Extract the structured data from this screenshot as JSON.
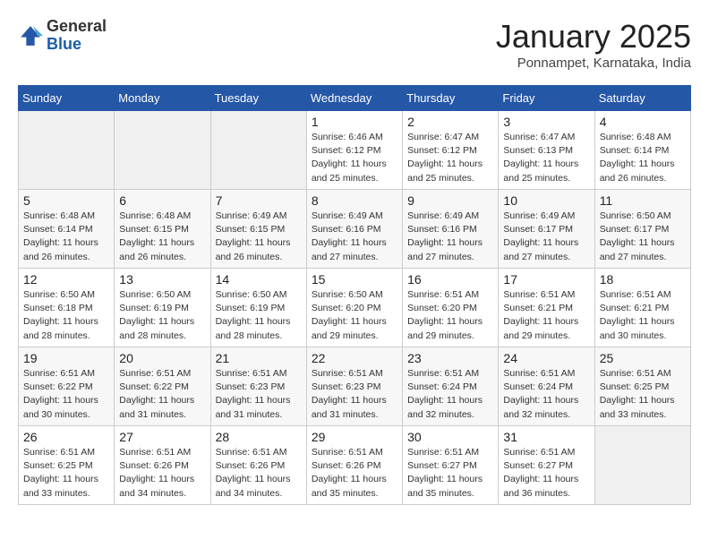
{
  "header": {
    "logo_general": "General",
    "logo_blue": "Blue",
    "month_title": "January 2025",
    "location": "Ponnampet, Karnataka, India"
  },
  "weekdays": [
    "Sunday",
    "Monday",
    "Tuesday",
    "Wednesday",
    "Thursday",
    "Friday",
    "Saturday"
  ],
  "weeks": [
    [
      {
        "day": "",
        "info": ""
      },
      {
        "day": "",
        "info": ""
      },
      {
        "day": "",
        "info": ""
      },
      {
        "day": "1",
        "info": "Sunrise: 6:46 AM\nSunset: 6:12 PM\nDaylight: 11 hours\nand 25 minutes."
      },
      {
        "day": "2",
        "info": "Sunrise: 6:47 AM\nSunset: 6:12 PM\nDaylight: 11 hours\nand 25 minutes."
      },
      {
        "day": "3",
        "info": "Sunrise: 6:47 AM\nSunset: 6:13 PM\nDaylight: 11 hours\nand 25 minutes."
      },
      {
        "day": "4",
        "info": "Sunrise: 6:48 AM\nSunset: 6:14 PM\nDaylight: 11 hours\nand 26 minutes."
      }
    ],
    [
      {
        "day": "5",
        "info": "Sunrise: 6:48 AM\nSunset: 6:14 PM\nDaylight: 11 hours\nand 26 minutes."
      },
      {
        "day": "6",
        "info": "Sunrise: 6:48 AM\nSunset: 6:15 PM\nDaylight: 11 hours\nand 26 minutes."
      },
      {
        "day": "7",
        "info": "Sunrise: 6:49 AM\nSunset: 6:15 PM\nDaylight: 11 hours\nand 26 minutes."
      },
      {
        "day": "8",
        "info": "Sunrise: 6:49 AM\nSunset: 6:16 PM\nDaylight: 11 hours\nand 27 minutes."
      },
      {
        "day": "9",
        "info": "Sunrise: 6:49 AM\nSunset: 6:16 PM\nDaylight: 11 hours\nand 27 minutes."
      },
      {
        "day": "10",
        "info": "Sunrise: 6:49 AM\nSunset: 6:17 PM\nDaylight: 11 hours\nand 27 minutes."
      },
      {
        "day": "11",
        "info": "Sunrise: 6:50 AM\nSunset: 6:17 PM\nDaylight: 11 hours\nand 27 minutes."
      }
    ],
    [
      {
        "day": "12",
        "info": "Sunrise: 6:50 AM\nSunset: 6:18 PM\nDaylight: 11 hours\nand 28 minutes."
      },
      {
        "day": "13",
        "info": "Sunrise: 6:50 AM\nSunset: 6:19 PM\nDaylight: 11 hours\nand 28 minutes."
      },
      {
        "day": "14",
        "info": "Sunrise: 6:50 AM\nSunset: 6:19 PM\nDaylight: 11 hours\nand 28 minutes."
      },
      {
        "day": "15",
        "info": "Sunrise: 6:50 AM\nSunset: 6:20 PM\nDaylight: 11 hours\nand 29 minutes."
      },
      {
        "day": "16",
        "info": "Sunrise: 6:51 AM\nSunset: 6:20 PM\nDaylight: 11 hours\nand 29 minutes."
      },
      {
        "day": "17",
        "info": "Sunrise: 6:51 AM\nSunset: 6:21 PM\nDaylight: 11 hours\nand 29 minutes."
      },
      {
        "day": "18",
        "info": "Sunrise: 6:51 AM\nSunset: 6:21 PM\nDaylight: 11 hours\nand 30 minutes."
      }
    ],
    [
      {
        "day": "19",
        "info": "Sunrise: 6:51 AM\nSunset: 6:22 PM\nDaylight: 11 hours\nand 30 minutes."
      },
      {
        "day": "20",
        "info": "Sunrise: 6:51 AM\nSunset: 6:22 PM\nDaylight: 11 hours\nand 31 minutes."
      },
      {
        "day": "21",
        "info": "Sunrise: 6:51 AM\nSunset: 6:23 PM\nDaylight: 11 hours\nand 31 minutes."
      },
      {
        "day": "22",
        "info": "Sunrise: 6:51 AM\nSunset: 6:23 PM\nDaylight: 11 hours\nand 31 minutes."
      },
      {
        "day": "23",
        "info": "Sunrise: 6:51 AM\nSunset: 6:24 PM\nDaylight: 11 hours\nand 32 minutes."
      },
      {
        "day": "24",
        "info": "Sunrise: 6:51 AM\nSunset: 6:24 PM\nDaylight: 11 hours\nand 32 minutes."
      },
      {
        "day": "25",
        "info": "Sunrise: 6:51 AM\nSunset: 6:25 PM\nDaylight: 11 hours\nand 33 minutes."
      }
    ],
    [
      {
        "day": "26",
        "info": "Sunrise: 6:51 AM\nSunset: 6:25 PM\nDaylight: 11 hours\nand 33 minutes."
      },
      {
        "day": "27",
        "info": "Sunrise: 6:51 AM\nSunset: 6:26 PM\nDaylight: 11 hours\nand 34 minutes."
      },
      {
        "day": "28",
        "info": "Sunrise: 6:51 AM\nSunset: 6:26 PM\nDaylight: 11 hours\nand 34 minutes."
      },
      {
        "day": "29",
        "info": "Sunrise: 6:51 AM\nSunset: 6:26 PM\nDaylight: 11 hours\nand 35 minutes."
      },
      {
        "day": "30",
        "info": "Sunrise: 6:51 AM\nSunset: 6:27 PM\nDaylight: 11 hours\nand 35 minutes."
      },
      {
        "day": "31",
        "info": "Sunrise: 6:51 AM\nSunset: 6:27 PM\nDaylight: 11 hours\nand 36 minutes."
      },
      {
        "day": "",
        "info": ""
      }
    ]
  ]
}
